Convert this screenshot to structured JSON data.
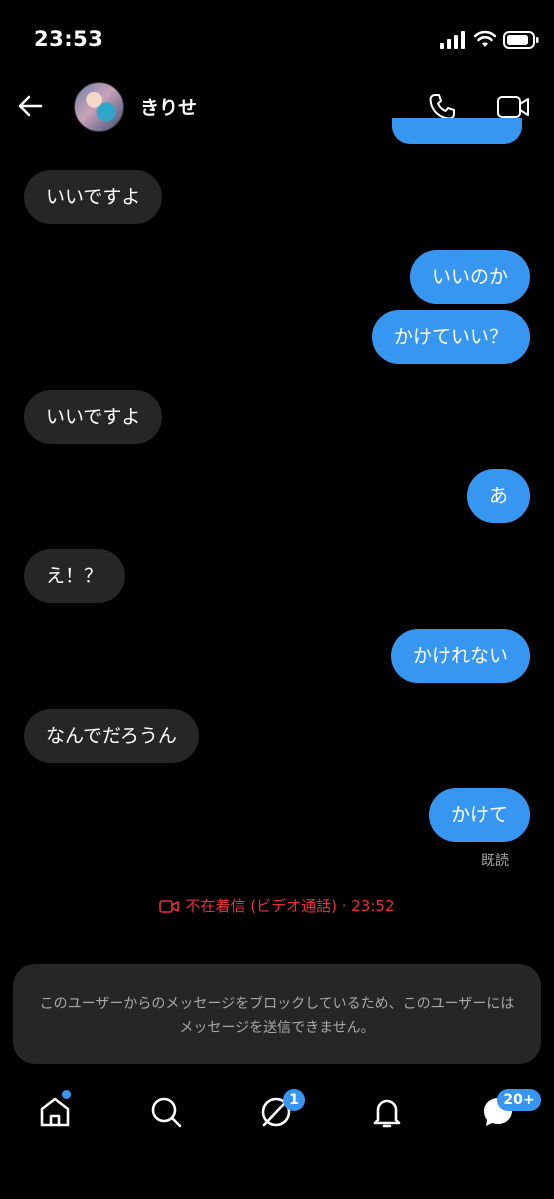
{
  "status_bar": {
    "time": "23:53"
  },
  "header": {
    "contact_name": "きりせ"
  },
  "messages": [
    {
      "direction": "received",
      "text": "いいですよ"
    },
    {
      "direction": "sent",
      "text": "いいのか"
    },
    {
      "direction": "sent",
      "text": "かけていい？"
    },
    {
      "direction": "received",
      "text": "いいですよ"
    },
    {
      "direction": "sent",
      "text": "あ"
    },
    {
      "direction": "received",
      "text": "え！？"
    },
    {
      "direction": "sent",
      "text": "かけれない"
    },
    {
      "direction": "received",
      "text": "なんでだろうん"
    },
    {
      "direction": "sent",
      "text": "かけて"
    }
  ],
  "read_receipt": "既読",
  "missed_call": "不在着信 (ビデオ通話) · 23:52",
  "block_notice": "このユーザーからのメッセージをブロックしているため、このユーザーにはメッセージを送信できません。",
  "bottom_nav": {
    "explore_badge": "1",
    "messages_badge": "20+"
  },
  "colors": {
    "accent": "#3797f0",
    "received_bubble": "#262626",
    "missed_call": "#ed2d3d"
  }
}
